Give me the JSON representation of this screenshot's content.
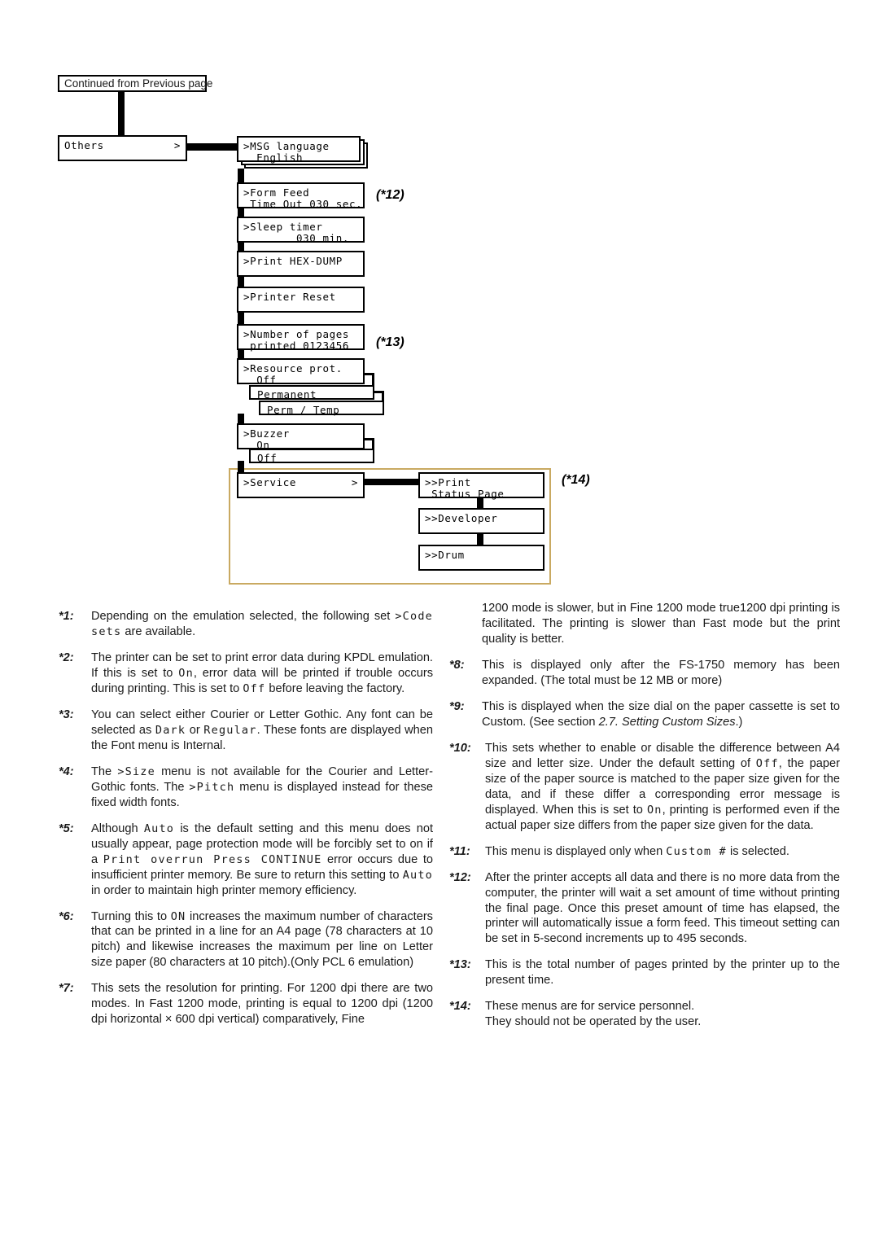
{
  "diagram": {
    "continued_label": "Continued from Previous page",
    "others": {
      "label": "Others",
      "arrow": ">"
    },
    "menu_items": [
      {
        "name": "msg-language",
        "line1": ">MSG language",
        "line2": "  English"
      },
      {
        "name": "form-feed",
        "line1": ">Form Feed",
        "line2": " Time Out 030 sec."
      },
      {
        "name": "sleep-timer",
        "line1": ">Sleep timer",
        "line2": "        030 min."
      },
      {
        "name": "print-hex-dump",
        "line1": ">Print HEX-DUMP",
        "line2": ""
      },
      {
        "name": "printer-reset",
        "line1": ">Printer Reset",
        "line2": ""
      },
      {
        "name": "number-of-pages",
        "line1": ">Number of pages",
        "line2": " printed 0123456"
      },
      {
        "name": "resource-prot",
        "line1": ">Resource prot.",
        "line2": "  Off"
      },
      {
        "name": "buzzer",
        "line1": ">Buzzer",
        "line2": "  On"
      }
    ],
    "resource_options": [
      "Permanent",
      "Perm / Temp"
    ],
    "buzzer_options": [
      "Off"
    ],
    "service": {
      "label": ">Service",
      "arrow": ">"
    },
    "service_items": [
      {
        "name": "print-status-page",
        "line1": ">>Print",
        "line2": " Status Page"
      },
      {
        "name": "developer",
        "line1": ">>Developer",
        "line2": ""
      },
      {
        "name": "drum",
        "line1": ">>Drum",
        "line2": ""
      }
    ],
    "annotations": {
      "n12": "(*12)",
      "n13": "(*13)",
      "n14": "(*14)"
    },
    "highlight_color": "#c9a961"
  },
  "footnotes": {
    "left": [
      {
        "tag": "*1:",
        "parts": [
          {
            "t": "Depending on the emulation selected, the following set "
          },
          {
            "t": ">Code sets",
            "lcd": true
          },
          {
            "t": " are available."
          }
        ]
      },
      {
        "tag": "*2:",
        "parts": [
          {
            "t": "The printer can be set to print error data during KPDL emulation. If this is set to "
          },
          {
            "t": "On",
            "lcd": true
          },
          {
            "t": ", error data will be printed if trouble occurs during printing. This is set to "
          },
          {
            "t": "Off",
            "lcd": true
          },
          {
            "t": " before leaving the factory."
          }
        ]
      },
      {
        "tag": "*3:",
        "parts": [
          {
            "t": "You can select either Courier or Letter Gothic. Any font can be selected as "
          },
          {
            "t": "Dark",
            "lcd": true
          },
          {
            "t": " or "
          },
          {
            "t": "Regular",
            "lcd": true
          },
          {
            "t": ". These fonts are displayed when the Font menu is Internal."
          }
        ]
      },
      {
        "tag": "*4:",
        "parts": [
          {
            "t": "The "
          },
          {
            "t": ">Size",
            "lcd": true
          },
          {
            "t": " menu is not available for the Courier and Letter-Gothic fonts. The "
          },
          {
            "t": ">Pitch",
            "lcd": true
          },
          {
            "t": " menu is displayed instead for these fixed width fonts."
          }
        ]
      },
      {
        "tag": "*5:",
        "parts": [
          {
            "t": "Although "
          },
          {
            "t": "Auto",
            "lcd": true
          },
          {
            "t": " is the default setting and this menu does not usually appear, page protection mode will be forcibly set to on if a "
          },
          {
            "t": "Print overrun Press CONTINUE",
            "lcd": true
          },
          {
            "t": " error occurs due to insufficient printer memory. Be sure to return this setting to "
          },
          {
            "t": "Auto",
            "lcd": true
          },
          {
            "t": " in order to maintain high printer memory efficiency."
          }
        ]
      },
      {
        "tag": "*6:",
        "parts": [
          {
            "t": "Turning this to "
          },
          {
            "t": "ON",
            "lcd": true
          },
          {
            "t": " increases the maximum number of characters that can be printed in a line for an A4 page (78 characters at 10 pitch) and likewise increases the maximum per line on Letter size paper (80 characters at 10 pitch).(Only PCL 6 emulation)"
          }
        ]
      },
      {
        "tag": "*7:",
        "parts": [
          {
            "t": "This sets the resolution for printing. For 1200 dpi there are two modes. In Fast 1200 mode, printing is equal to 1200 dpi (1200 dpi horizontal × 600 dpi vertical) comparatively, Fine"
          }
        ]
      }
    ],
    "right": [
      {
        "tag": "",
        "continuation": true,
        "parts": [
          {
            "t": "1200 mode is slower, but in Fine 1200 mode true1200 dpi printing is facilitated. The printing is slower than Fast mode but the print quality is better."
          }
        ]
      },
      {
        "tag": "*8:",
        "parts": [
          {
            "t": "This is displayed only after the FS-1750 memory has been expanded. (The total must be 12 MB or more)"
          }
        ]
      },
      {
        "tag": "*9:",
        "parts": [
          {
            "t": "This is displayed when the size dial on the paper cassette is set to Custom. (See section "
          },
          {
            "t": "2.7. Setting Custom Sizes",
            "ital": true
          },
          {
            "t": ".)"
          }
        ]
      },
      {
        "tag": "*10:",
        "parts": [
          {
            "t": "This sets whether to enable or disable the difference between A4 size and letter size. Under the default setting of "
          },
          {
            "t": "Off",
            "lcd": true
          },
          {
            "t": ", the paper size of the paper source is matched to the paper size given for the data, and if these differ a corresponding error message is displayed. When this is set to "
          },
          {
            "t": "On",
            "lcd": true
          },
          {
            "t": ", printing is performed even if the actual paper size differs from the paper size given for the data."
          }
        ]
      },
      {
        "tag": "*11:",
        "parts": [
          {
            "t": "This menu is displayed only when "
          },
          {
            "t": "Custom #",
            "lcd": true
          },
          {
            "t": " is selected."
          }
        ]
      },
      {
        "tag": "*12:",
        "parts": [
          {
            "t": "After the printer accepts all data and there is no more data from the computer, the printer will wait a set amount of time without printing the final page. Once this preset amount of time has elapsed, the printer will automatically issue a form feed. This timeout setting can be set in 5-second increments up to 495 seconds."
          }
        ]
      },
      {
        "tag": "*13:",
        "parts": [
          {
            "t": "This is the total number of pages printed by the printer up to the present time."
          }
        ]
      },
      {
        "tag": "*14:",
        "parts": [
          {
            "t": "These menus are for service personnel."
          },
          {
            "t": "\nThey should not be operated by the user.",
            "br": true
          }
        ]
      }
    ]
  }
}
